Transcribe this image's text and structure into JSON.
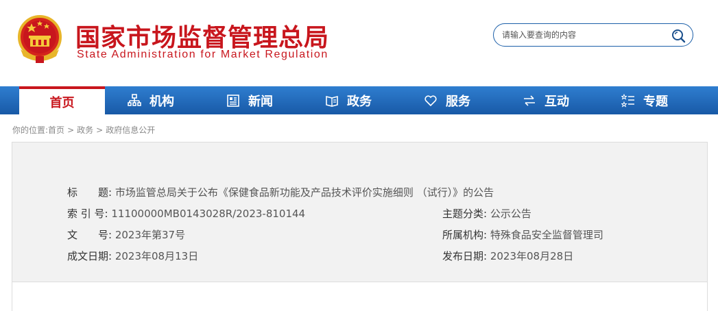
{
  "header": {
    "title_cn": "国家市场监督管理总局",
    "title_en": "State Administration for Market Regulation",
    "logo_icon": "national-emblem-icon"
  },
  "search": {
    "placeholder": "请输入要查询的内容",
    "icon": "search-icon"
  },
  "nav": {
    "items": [
      {
        "label": "首页",
        "icon": "",
        "active": true
      },
      {
        "label": "机构",
        "icon": "org-chart-icon"
      },
      {
        "label": "新闻",
        "icon": "newspaper-icon"
      },
      {
        "label": "政务",
        "icon": "open-book-icon"
      },
      {
        "label": "服务",
        "icon": "heart-icon"
      },
      {
        "label": "互动",
        "icon": "swap-arrows-icon"
      },
      {
        "label": "专题",
        "icon": "star-list-icon"
      }
    ]
  },
  "breadcrumb": {
    "prefix": "你的位置:",
    "items": [
      "首页",
      "政务",
      "政府信息公开"
    ],
    "separator": ">"
  },
  "document": {
    "title_label": "标　　题:",
    "title_value": "市场监管总局关于公布《保健食品新功能及产品技术评价实施细则 （试行）》的公告",
    "index_label": "索 引 号:",
    "index_value": "11100000MB0143028R/2023-810144",
    "category_label": "主题分类:",
    "category_value": "公示公告",
    "doc_no_label": "文　　号:",
    "doc_no_value": "2023年第37号",
    "org_label": "所属机构:",
    "org_value": "特殊食品安全监督管理司",
    "created_label": "成文日期:",
    "created_value": "2023年08月13日",
    "published_label": "发布日期:",
    "published_value": "2023年08月28日"
  },
  "colors": {
    "brand_red": "#c8161d",
    "nav_blue": "#1f67b6",
    "panel_gray": "#f2f2f2"
  }
}
